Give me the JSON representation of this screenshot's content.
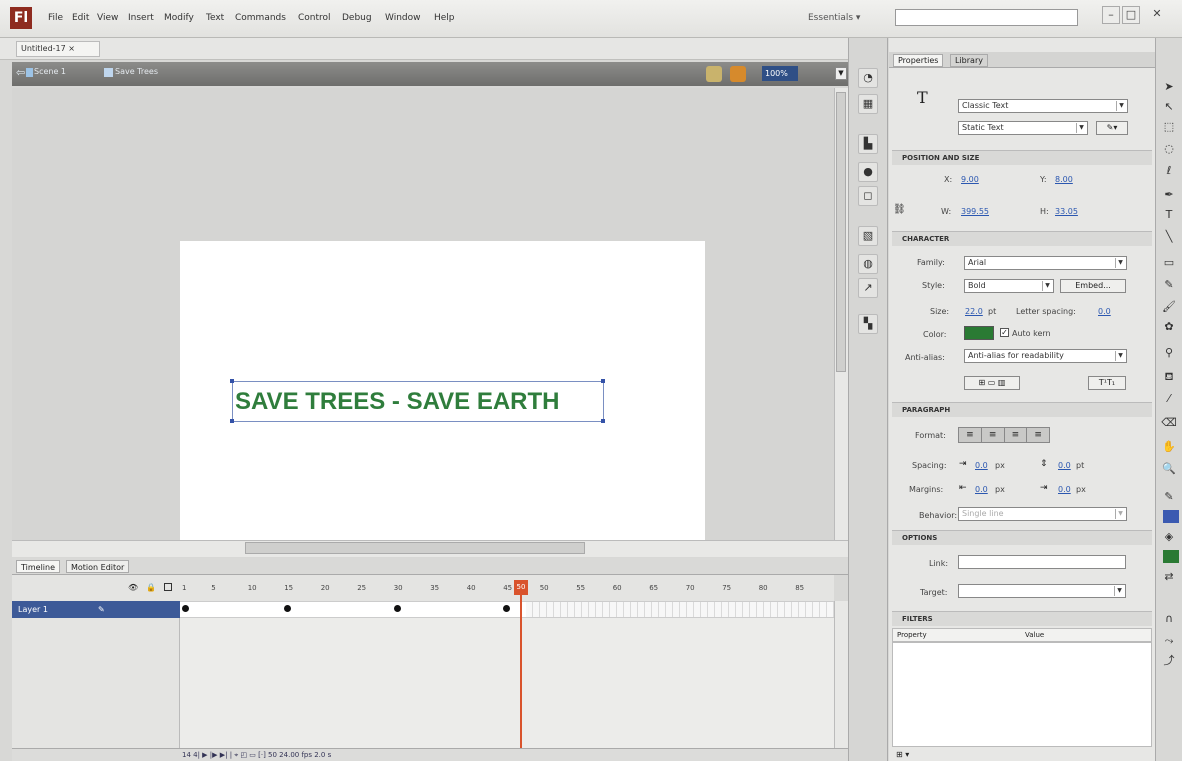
{
  "app": {
    "logo": "Fl",
    "menu": [
      "File",
      "Edit",
      "View",
      "Insert",
      "Modify",
      "Text",
      "Commands",
      "Control",
      "Debug",
      "Window",
      "Help"
    ],
    "workspace": "Essentials ▾",
    "search_placeholder": "",
    "window_controls": [
      "–",
      "□",
      "✕"
    ]
  },
  "document": {
    "tab_label": "Untitled-17 ×",
    "scene_label": "Scene 1",
    "symbol_label": "Save Trees",
    "zoom": "100%"
  },
  "stage": {
    "text": "SAVE TREES - SAVE EARTH",
    "text_color": "#2f7d3c"
  },
  "timeline": {
    "tabs": [
      "Timeline",
      "Motion Editor"
    ],
    "layer_name": "Layer 1",
    "frame_numbers": [
      "1",
      "5",
      "10",
      "15",
      "20",
      "25",
      "30",
      "35",
      "40",
      "45",
      "50",
      "55",
      "60",
      "65",
      "70",
      "75",
      "80",
      "85"
    ],
    "current_frame": "50",
    "keyframes": [
      15,
      30,
      45
    ],
    "status": "14  4|  ▶  |▶  ▶|   |  ⌖  ◰  ▭  [·]   50   24.00 fps   2.0 s"
  },
  "properties": {
    "tabs": [
      "Properties",
      "Library"
    ],
    "tool_icon": "T",
    "text_engine": "Classic Text",
    "text_type": "Static Text",
    "sections": {
      "position": "POSITION AND SIZE",
      "character": "CHARACTER",
      "paragraph": "PARAGRAPH",
      "options": "OPTIONS",
      "filters": "FILTERS"
    },
    "position": {
      "x_label": "X:",
      "x": "9.00",
      "y_label": "Y:",
      "y": "8.00",
      "w_label": "W:",
      "w": "399.55",
      "h_label": "H:",
      "h": "33.05"
    },
    "character": {
      "family_label": "Family:",
      "family": "Arial",
      "style_label": "Style:",
      "style": "Bold",
      "embed_button": "Embed...",
      "size_label": "Size:",
      "size": "22.0",
      "size_unit": "pt",
      "letter_spacing_label": "Letter spacing:",
      "letter_spacing": "0.0",
      "color_label": "Color:",
      "color": "#2a7a33",
      "autokern_label": "Auto kern",
      "antialias_label": "Anti-alias:",
      "antialias": "Anti-alias for readability"
    },
    "paragraph": {
      "format_label": "Format:",
      "spacing_label": "Spacing:",
      "indent": "0.0",
      "indent_unit": "px",
      "line_spacing": "0.0",
      "line_spacing_unit": "pt",
      "margins_label": "Margins:",
      "left_margin": "0.0",
      "right_margin": "0.0",
      "margin_unit": "px",
      "behavior_label": "Behavior:",
      "behavior": "Single line"
    },
    "options": {
      "link_label": "Link:",
      "link": "",
      "target_label": "Target:",
      "target": ""
    },
    "filters": {
      "col_property": "Property",
      "col_value": "Value"
    }
  }
}
